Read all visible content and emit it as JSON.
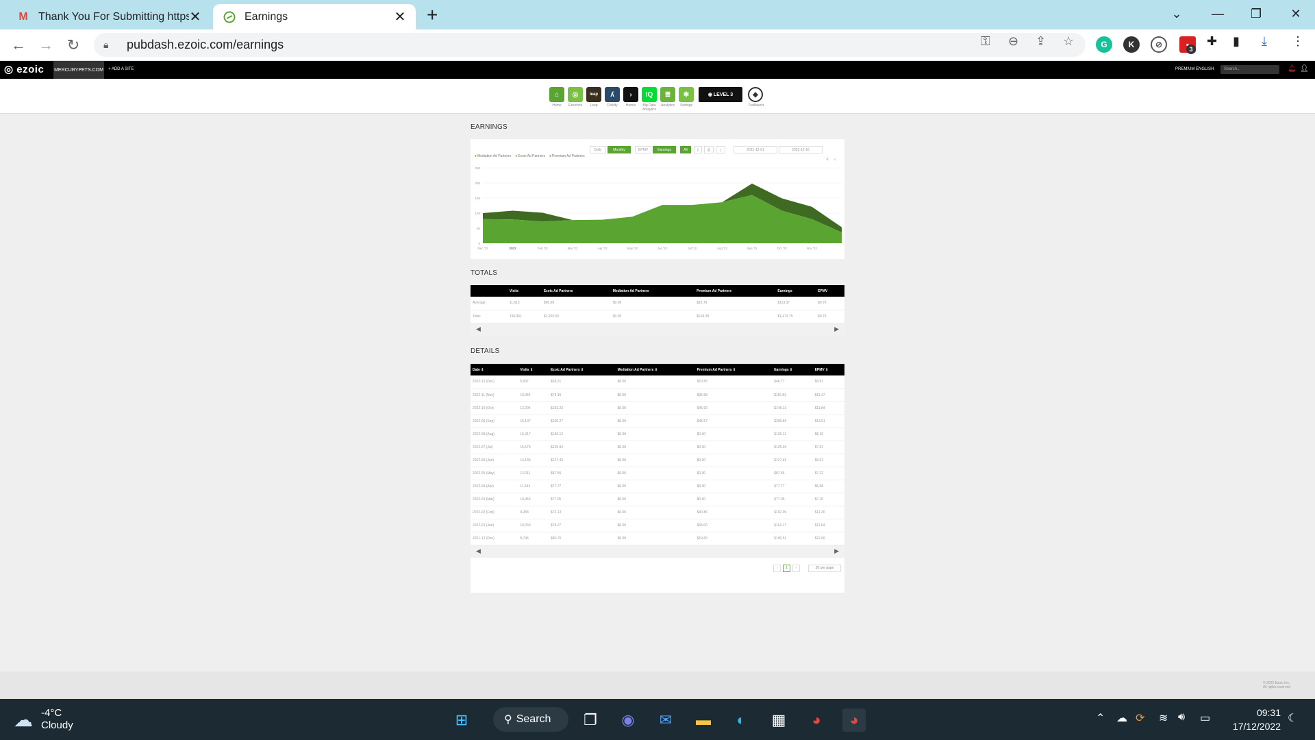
{
  "browser": {
    "tabs": [
      {
        "title": "Thank You For Submitting https:/",
        "icon": "gmail-icon"
      },
      {
        "title": "Earnings",
        "icon": "ezoic-icon"
      }
    ],
    "url": "pubdash.ezoic.com/earnings",
    "extension_badge": "3"
  },
  "ezoic_nav": {
    "logo": "ezoic",
    "site": "MERCURYPETS.COM",
    "add_site": "+ ADD A SITE",
    "premium": "PREMIUM",
    "language": "ENGLISH",
    "search_placeholder": "Search..."
  },
  "apps": [
    {
      "label": "Home",
      "color": "#5aa531",
      "glyph": "⌂"
    },
    {
      "label": "Ezoicbox",
      "color": "#7bc043",
      "glyph": "◎"
    },
    {
      "label": "Leap",
      "color": "#3a2f1e",
      "glyph": "leap"
    },
    {
      "label": "Flickify",
      "color": "#2a4a6a",
      "glyph": "ʎ"
    },
    {
      "label": "Humix",
      "color": "#111",
      "glyph": "›"
    },
    {
      "label": "Big Data Analytics",
      "color": "#0d3",
      "glyph": "IQ"
    },
    {
      "label": "Analytics",
      "color": "#6bb33a",
      "glyph": "≣"
    },
    {
      "label": "Settings",
      "color": "#79c142",
      "glyph": "✱"
    }
  ],
  "level_badge": "LEVEL 3",
  "trailblazer": "Trailblazer",
  "earnings": {
    "title": "EARNINGS",
    "controls": {
      "daily": "Daily",
      "monthly": "Monthly",
      "epmv": "EPMV",
      "earnings": "Earnings",
      "all": "All",
      "date_from": "2021-12-01",
      "date_to": "2022-12-16"
    },
    "legend": [
      "Mediation Ad Partners",
      "Ezoic Ad Partners",
      "Premium Ad Partners"
    ]
  },
  "chart_data": {
    "type": "area",
    "categories": [
      "Dec '21",
      "2022",
      "Feb '22",
      "Mar '22",
      "Apr '22",
      "May '22",
      "Jun '22",
      "Jul '22",
      "Aug '22",
      "Sep '22",
      "Oct '22",
      "Nov '22",
      "Dec '22"
    ],
    "x_labels": [
      "Dec '21",
      "2022",
      "Feb '22",
      "Mar '22",
      "Apr '22",
      "May '22",
      "Jun '22",
      "Jul '22",
      "Aug '22",
      "Sep '22",
      "Oct '22",
      "Nov '22"
    ],
    "y_ticks": [
      "250",
      "200",
      "150",
      "100",
      "50",
      "0"
    ],
    "ylim": [
      0,
      250
    ],
    "series": [
      {
        "name": "Ezoic Ad Partners",
        "color": "#5aa531",
        "values": [
          80,
          79,
          72,
          77,
          78,
          88,
          127,
          127,
          136,
          160,
          108,
          80,
          36
        ]
      },
      {
        "name": "Premium Ad Partners",
        "color": "#3e6a22",
        "values": [
          20,
          29,
          29,
          0,
          0,
          0,
          0,
          0,
          0,
          38,
          41,
          41,
          17
        ]
      }
    ]
  },
  "totals": {
    "title": "TOTALS",
    "headers": [
      "",
      "Visits",
      "Ezoic Ad Partners",
      "Mediation Ad Partners",
      "Premium Ad Partners",
      "Earnings",
      "EPMV"
    ],
    "rows": [
      [
        "Average:",
        "11,612",
        "$96.58",
        "$0.00",
        "$16.79",
        "$113.37",
        "$9.76"
      ],
      [
        "Total:",
        "150,961",
        "$1,255.50",
        "$0.00",
        "$218.28",
        "$1,473.75",
        "$9.76"
      ]
    ]
  },
  "details": {
    "title": "DETAILS",
    "headers": [
      "Date",
      "Visits",
      "Ezoic Ad Partners",
      "Mediation Ad Partners",
      "Premium Ad Partners",
      "Earnings",
      "EPMV"
    ],
    "rows": [
      [
        "2022-12 (Dec)",
        "5,937",
        "$36.21",
        "$0.00",
        "$10.56",
        "$46.77",
        "$9.91"
      ],
      [
        "2022-11 (Nov)",
        "10,344",
        "$79.15",
        "$0.00",
        "$36.68",
        "$115.83",
        "$11.47"
      ],
      [
        "2022-10 (Oct)",
        "12,204",
        "$102.23",
        "$0.00",
        "$45.90",
        "$148.13",
        "$11.84"
      ],
      [
        "2022-09 (Sep)",
        "15,197",
        "$160.27",
        "$0.00",
        "$45.57",
        "$205.84",
        "$13.51"
      ],
      [
        "2022-08 (Aug)",
        "16,317",
        "$136.12",
        "$0.00",
        "$0.00",
        "$136.12",
        "$8.16"
      ],
      [
        "2022-07 (Jul)",
        "15,579",
        "$125.94",
        "$0.00",
        "$0.00",
        "$125.94",
        "$7.92"
      ],
      [
        "2022-06 (Jun)",
        "14,183",
        "$127.43",
        "$0.00",
        "$0.00",
        "$127.43",
        "$9.01"
      ],
      [
        "2022-05 (May)",
        "12,011",
        "$87.55",
        "$0.00",
        "$0.00",
        "$87.55",
        "$7.22"
      ],
      [
        "2022-04 (Apr)",
        "11,543",
        "$77.77",
        "$0.00",
        "$0.00",
        "$77.77",
        "$6.58"
      ],
      [
        "2022-03 (Mar)",
        "10,453",
        "$77.05",
        "$0.00",
        "$0.00",
        "$77.05",
        "$7.15"
      ],
      [
        "2022-02 (Feb)",
        "9,283",
        "$72.13",
        "$0.00",
        "$30.86",
        "$102.99",
        "$11.30"
      ],
      [
        "2022-01 (Jan)",
        "10,330",
        "$78.27",
        "$0.00",
        "$36.00",
        "$114.17",
        "$11.04"
      ],
      [
        "2021-12 (Dec)",
        "8,746",
        "$80.70",
        "$0.00",
        "$19.82",
        "$100.52",
        "$12.06"
      ]
    ],
    "page": "1",
    "per_page": "20 per page"
  },
  "footer": {
    "copyright": "© 2022 Ezoic Inc.",
    "rights": "All rights reserved"
  },
  "taskbar": {
    "temp": "-4°C",
    "condition": "Cloudy",
    "search": "Search",
    "time": "09:31",
    "date": "17/12/2022"
  }
}
